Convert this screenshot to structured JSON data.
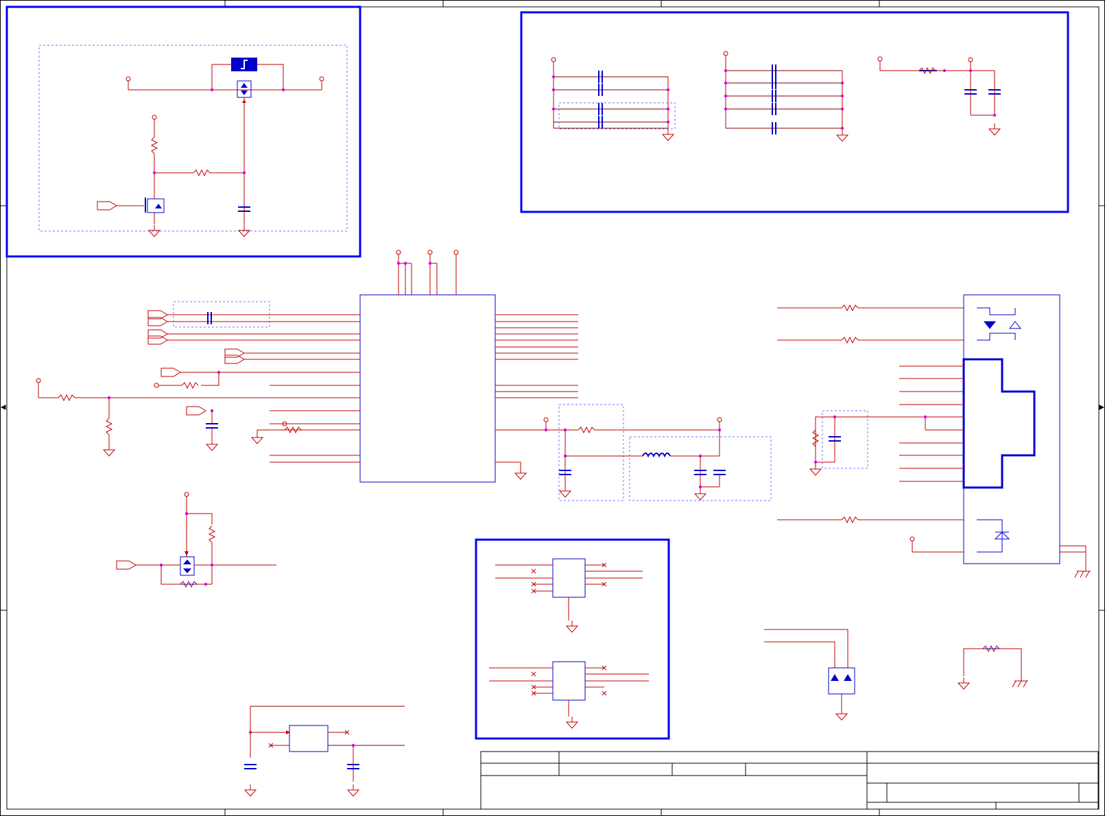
{
  "sheet": {
    "type": "electronic schematic",
    "frame_color": "#000000",
    "border_zone_markers": true,
    "title_block": {
      "present": true,
      "text": ""
    },
    "visible_text": ""
  },
  "colors": {
    "wire": "#c00000",
    "wire_dark": "#800000",
    "part": "#0000cc",
    "box": "#0000ff",
    "junction": "#e000e0",
    "dashed": "#7070ff",
    "frame": "#000000"
  },
  "components": {
    "main_ic": {
      "kind": "ic",
      "pin_count_left": 13,
      "pin_count_right": 12
    },
    "connector": {
      "kind": "rj45-magjack",
      "pin_count": 16
    },
    "small_ics": [
      {
        "kind": "ic",
        "pins": 8
      },
      {
        "kind": "ic",
        "pins": 8
      },
      {
        "kind": "oscillator",
        "pins": 4
      }
    ],
    "mosfets": 2,
    "diode_arrays": 1,
    "fuse": 1
  }
}
